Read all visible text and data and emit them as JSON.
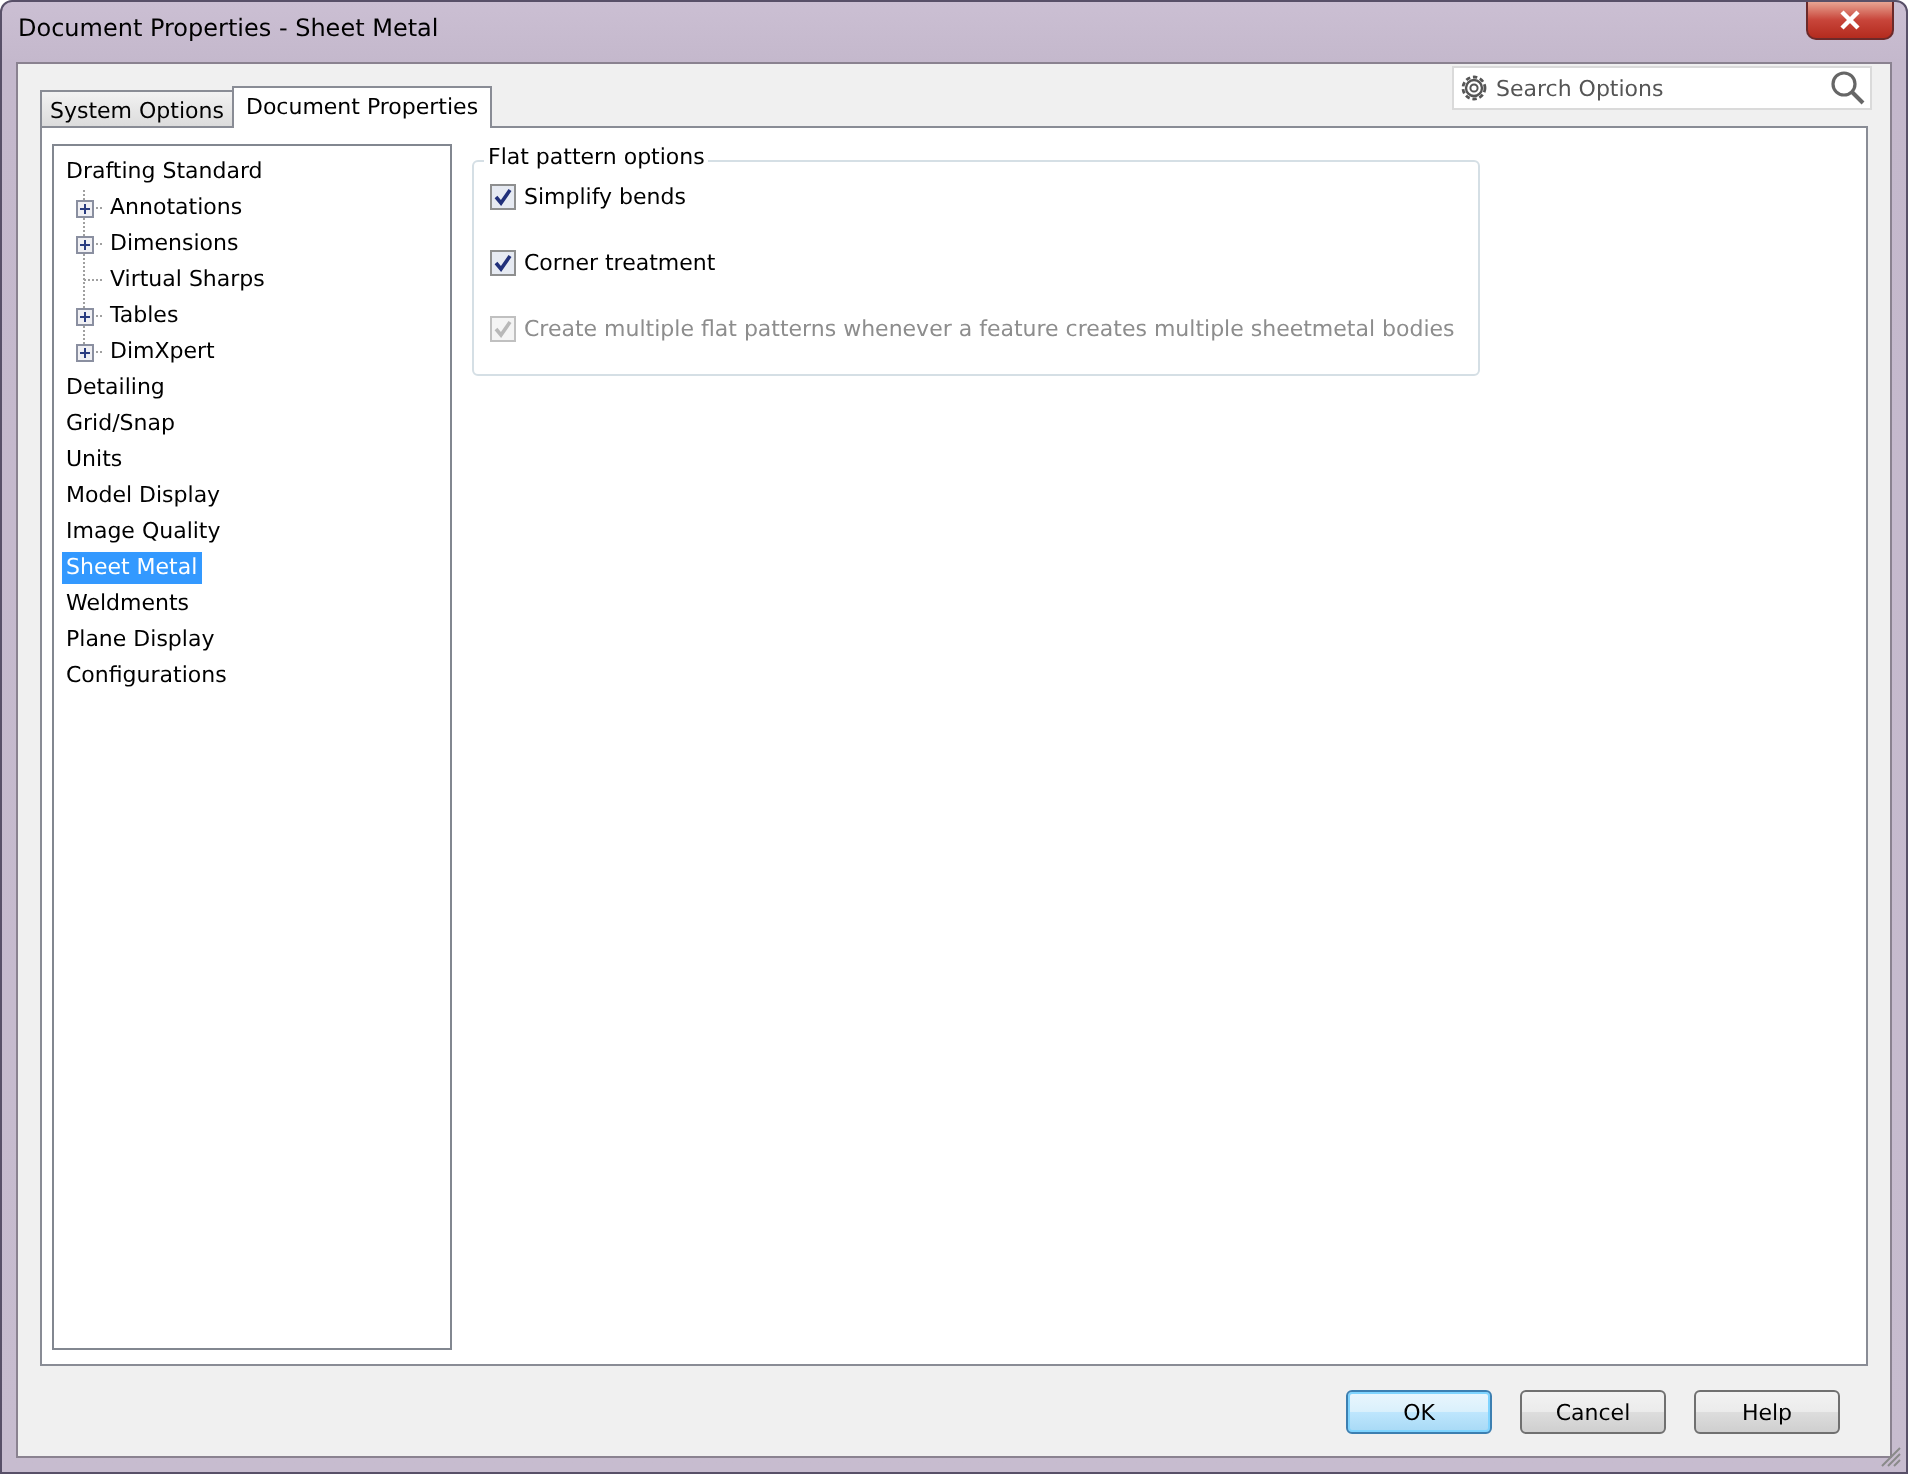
{
  "window": {
    "title": "Document Properties - Sheet Metal"
  },
  "tabs": [
    {
      "label": "System Options",
      "selected": false
    },
    {
      "label": "Document Properties",
      "selected": true
    }
  ],
  "search": {
    "placeholder": "Search Options"
  },
  "tree": [
    {
      "label": "Drafting Standard",
      "selected": false,
      "children": [
        {
          "label": "Annotations",
          "selected": false,
          "expanded": false
        },
        {
          "label": "Dimensions",
          "selected": false,
          "expanded": false
        },
        {
          "label": "Virtual Sharps",
          "selected": false
        },
        {
          "label": "Tables",
          "selected": false,
          "expanded": false
        },
        {
          "label": "DimXpert",
          "selected": false,
          "expanded": false
        }
      ]
    },
    {
      "label": "Detailing",
      "selected": false
    },
    {
      "label": "Grid/Snap",
      "selected": false
    },
    {
      "label": "Units",
      "selected": false
    },
    {
      "label": "Model Display",
      "selected": false
    },
    {
      "label": "Image Quality",
      "selected": false
    },
    {
      "label": "Sheet Metal",
      "selected": true
    },
    {
      "label": "Weldments",
      "selected": false
    },
    {
      "label": "Plane Display",
      "selected": false
    },
    {
      "label": "Configurations",
      "selected": false
    }
  ],
  "group": {
    "title": "Flat pattern options",
    "options": [
      {
        "label": "Simplify bends",
        "checked": true,
        "disabled": false
      },
      {
        "label": "Corner treatment",
        "checked": true,
        "disabled": false
      },
      {
        "label": "Create multiple flat patterns whenever a feature creates multiple sheetmetal bodies",
        "checked": true,
        "disabled": true
      }
    ]
  },
  "buttons": [
    {
      "label": "OK",
      "default": true
    },
    {
      "label": "Cancel",
      "default": false
    },
    {
      "label": "Help",
      "default": false
    }
  ]
}
